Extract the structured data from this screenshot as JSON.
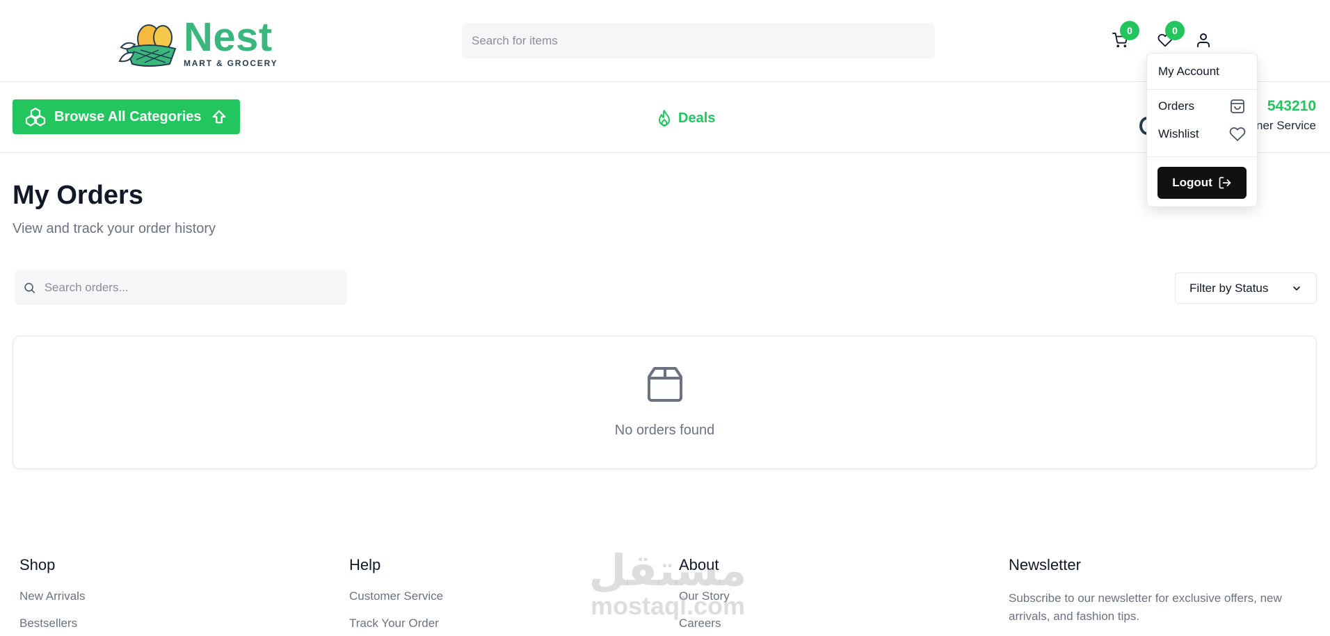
{
  "header": {
    "logo_name": "Nest",
    "logo_tagline": "MART & GROCERY",
    "search_placeholder": "Search for items",
    "cart_count": "0",
    "wishlist_count": "0"
  },
  "nav": {
    "browse_label": "Browse All Categories",
    "deals_label": "Deals",
    "support_phone": "543210",
    "support_label": "ner Service"
  },
  "account_menu": {
    "title": "My Account",
    "items": [
      {
        "label": "Orders",
        "icon": "shopping-bag-icon"
      },
      {
        "label": "Wishlist",
        "icon": "heart-icon"
      }
    ],
    "logout_label": "Logout"
  },
  "main": {
    "title": "My Orders",
    "subtitle": "View and track your order history",
    "search_placeholder": "Search orders...",
    "filter_label": "Filter by Status",
    "empty_text": "No orders found"
  },
  "footer": {
    "shop": {
      "title": "Shop",
      "links": [
        "New Arrivals",
        "Bestsellers"
      ]
    },
    "help": {
      "title": "Help",
      "links": [
        "Customer Service",
        "Track Your Order"
      ]
    },
    "about": {
      "title": "About",
      "links": [
        "Our Story",
        "Careers"
      ]
    },
    "newsletter": {
      "title": "Newsletter",
      "text": "Subscribe to our newsletter for exclusive offers, new arrivals, and fashion tips."
    }
  },
  "watermark": {
    "arabic": "مستقل",
    "latin": "mostaql.com"
  },
  "colors": {
    "brand_green": "#22c55e",
    "logo_green": "#3bb77e",
    "dark": "#111111"
  }
}
